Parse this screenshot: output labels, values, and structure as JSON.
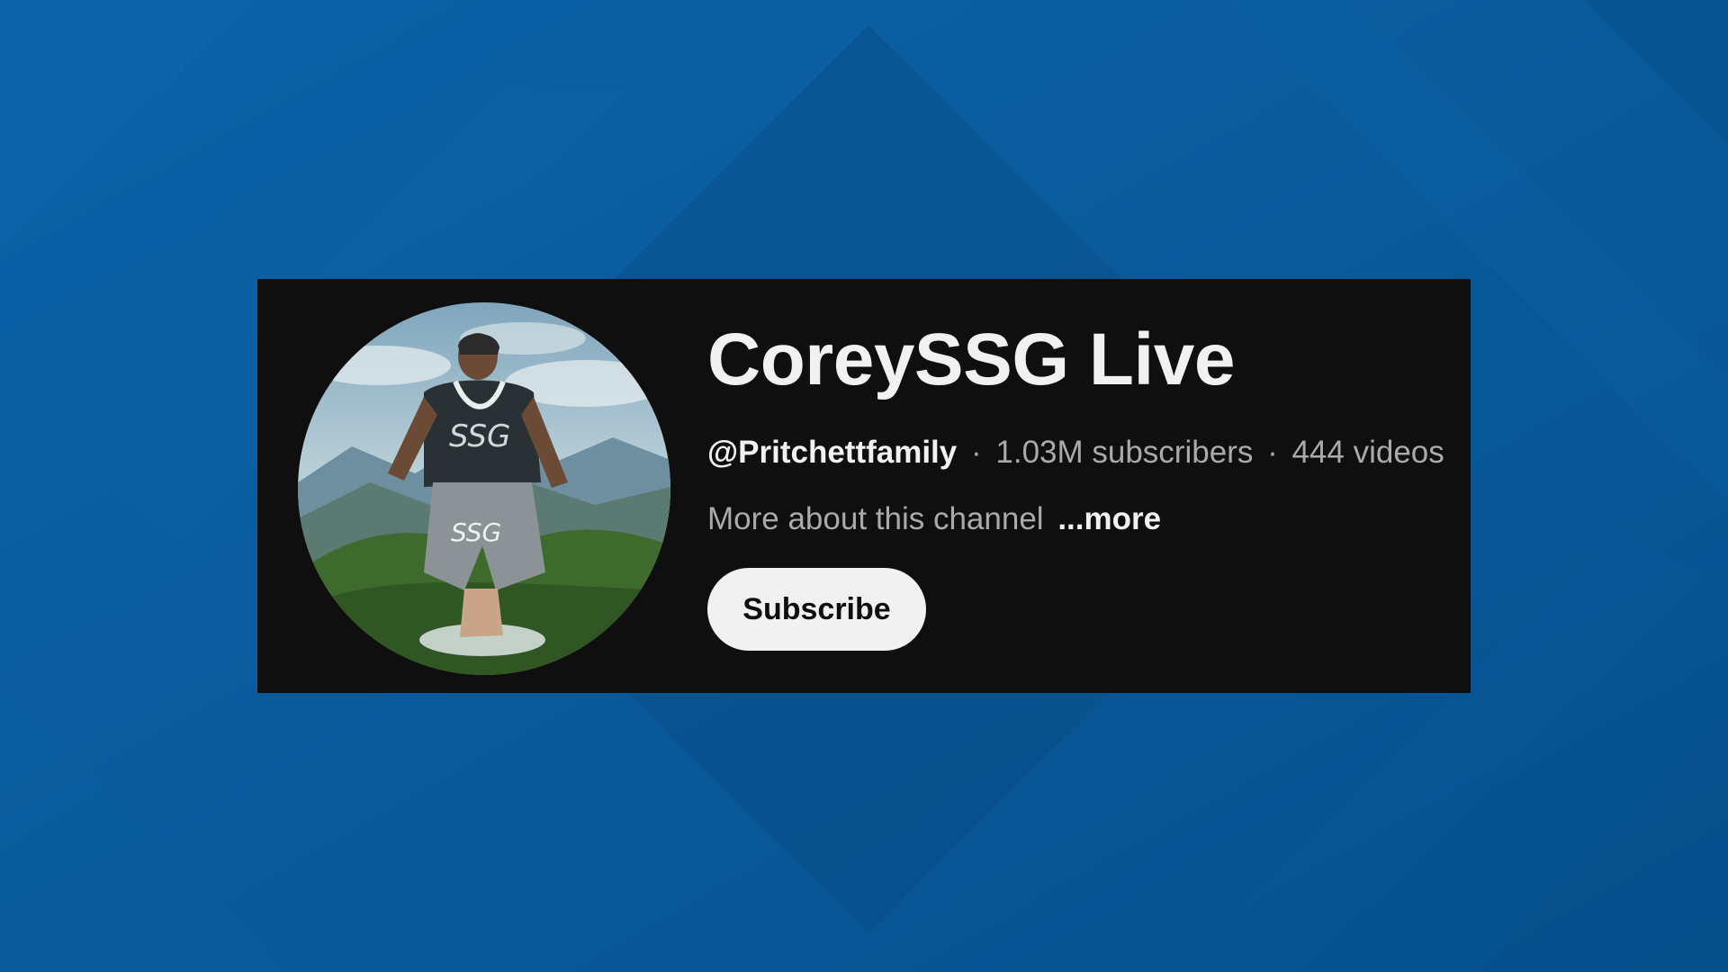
{
  "colors": {
    "background": "#0a5a9c",
    "card": "#0f0f0f",
    "title_text": "#f1f1f1",
    "secondary_text": "#aaaaaa",
    "button_bg": "#f1f1f1",
    "button_text": "#0f0f0f"
  },
  "channel": {
    "title": "CoreySSG Live",
    "handle": "@Pritchettfamily",
    "separator": "·",
    "subscribers": "1.03M subscribers",
    "videos": "444 videos",
    "description": "More about this channel",
    "more_label": "...more",
    "avatar_icon": "channel-avatar-photo"
  },
  "actions": {
    "subscribe_label": "Subscribe"
  }
}
